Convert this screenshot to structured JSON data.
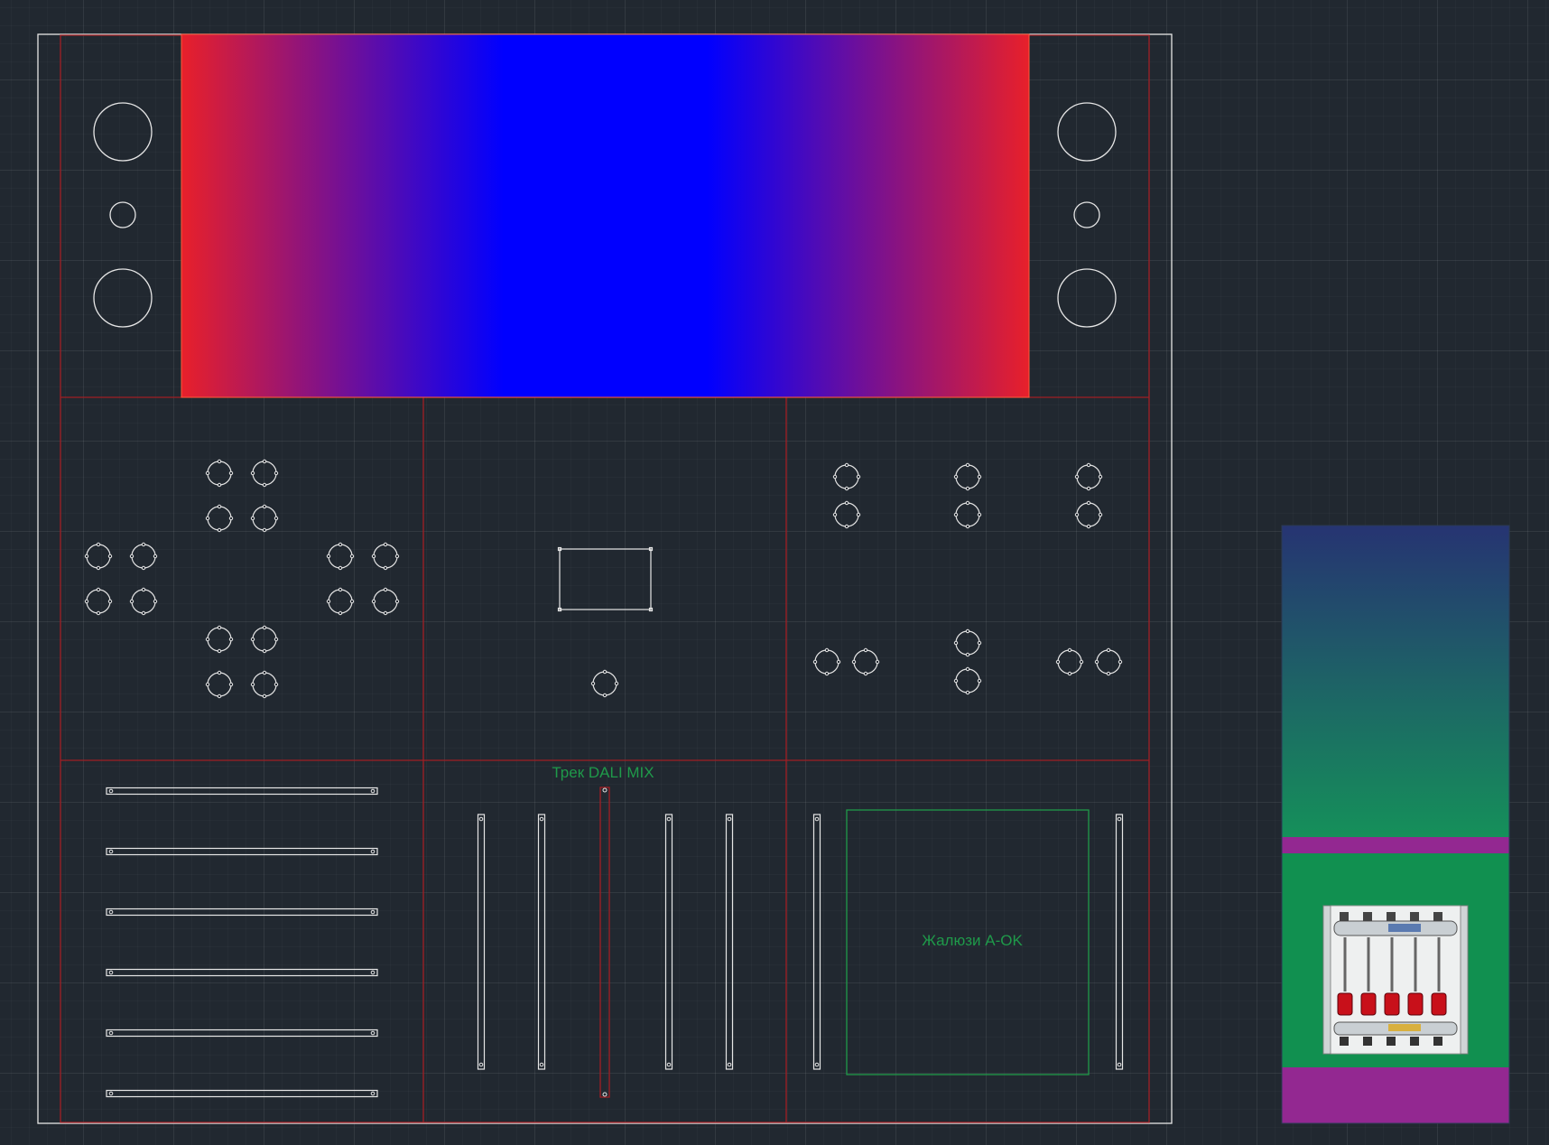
{
  "drawing": {
    "track_label": "Трек DALI MIX",
    "blinds_label": "Жалюзи A-OK"
  },
  "colors": {
    "background": "#212830",
    "outline": "#e6e6e6",
    "partition": "#a01e24",
    "annotation": "#1f9a4a",
    "gradient_edge": "#e8202a",
    "gradient_center": "#0000ff",
    "side_panel_top": "#263472",
    "side_panel_green": "#119050",
    "side_panel_band": "#932891"
  },
  "icons": {
    "mount_hole": "round-mount-hole-icon",
    "dali_module": "dali-module-outline-icon",
    "manifold": "underfloor-heating-manifold-icon"
  }
}
